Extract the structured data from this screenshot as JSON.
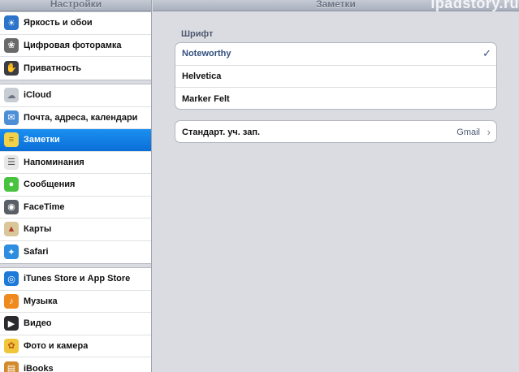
{
  "sidebar": {
    "title": "Настройки",
    "groups": [
      {
        "items": [
          {
            "label": "Яркость и обои",
            "icon": "brightness-icon",
            "color": "#2b74c9"
          },
          {
            "label": "Цифровая фоторамка",
            "icon": "photo-frame-icon",
            "color": "#6a6a6a"
          },
          {
            "label": "Приватность",
            "icon": "privacy-hand-icon",
            "color": "#3a3d44"
          }
        ]
      },
      {
        "items": [
          {
            "label": "iCloud",
            "icon": "icloud-icon",
            "color": "#c8ccd3"
          },
          {
            "label": "Почта, адреса, календари",
            "icon": "mail-icon",
            "color": "#4d8fd6"
          },
          {
            "label": "Заметки",
            "icon": "notes-icon",
            "color": "#f2d24b",
            "selected": true
          },
          {
            "label": "Напоминания",
            "icon": "reminders-icon",
            "color": "#e7e7e7"
          },
          {
            "label": "Сообщения",
            "icon": "messages-icon",
            "color": "#48c340"
          },
          {
            "label": "FaceTime",
            "icon": "facetime-icon",
            "color": "#5a5e66"
          },
          {
            "label": "Карты",
            "icon": "maps-icon",
            "color": "#d9c79a"
          },
          {
            "label": "Safari",
            "icon": "safari-icon",
            "color": "#2d8ee0"
          }
        ]
      },
      {
        "items": [
          {
            "label": "iTunes Store и App Store",
            "icon": "app-store-icon",
            "color": "#1d7ad8"
          },
          {
            "label": "Музыка",
            "icon": "music-icon",
            "color": "#f08a1e"
          },
          {
            "label": "Видео",
            "icon": "video-icon",
            "color": "#2a2a2e"
          },
          {
            "label": "Фото и камера",
            "icon": "photos-icon",
            "color": "#f0c53a"
          },
          {
            "label": "iBooks",
            "icon": "ibooks-icon",
            "color": "#d28a2a"
          }
        ]
      }
    ]
  },
  "main": {
    "title": "Заметки",
    "watermark": "ipadstory.ru",
    "font_section_title": "Шрифт",
    "fonts": [
      {
        "label": "Noteworthy",
        "checked": true
      },
      {
        "label": "Helvetica",
        "checked": false
      },
      {
        "label": "Marker Felt",
        "checked": false
      }
    ],
    "check_glyph": "✓",
    "account": {
      "label": "Стандарт. уч. зап.",
      "value": "Gmail",
      "chevron": "›"
    }
  }
}
